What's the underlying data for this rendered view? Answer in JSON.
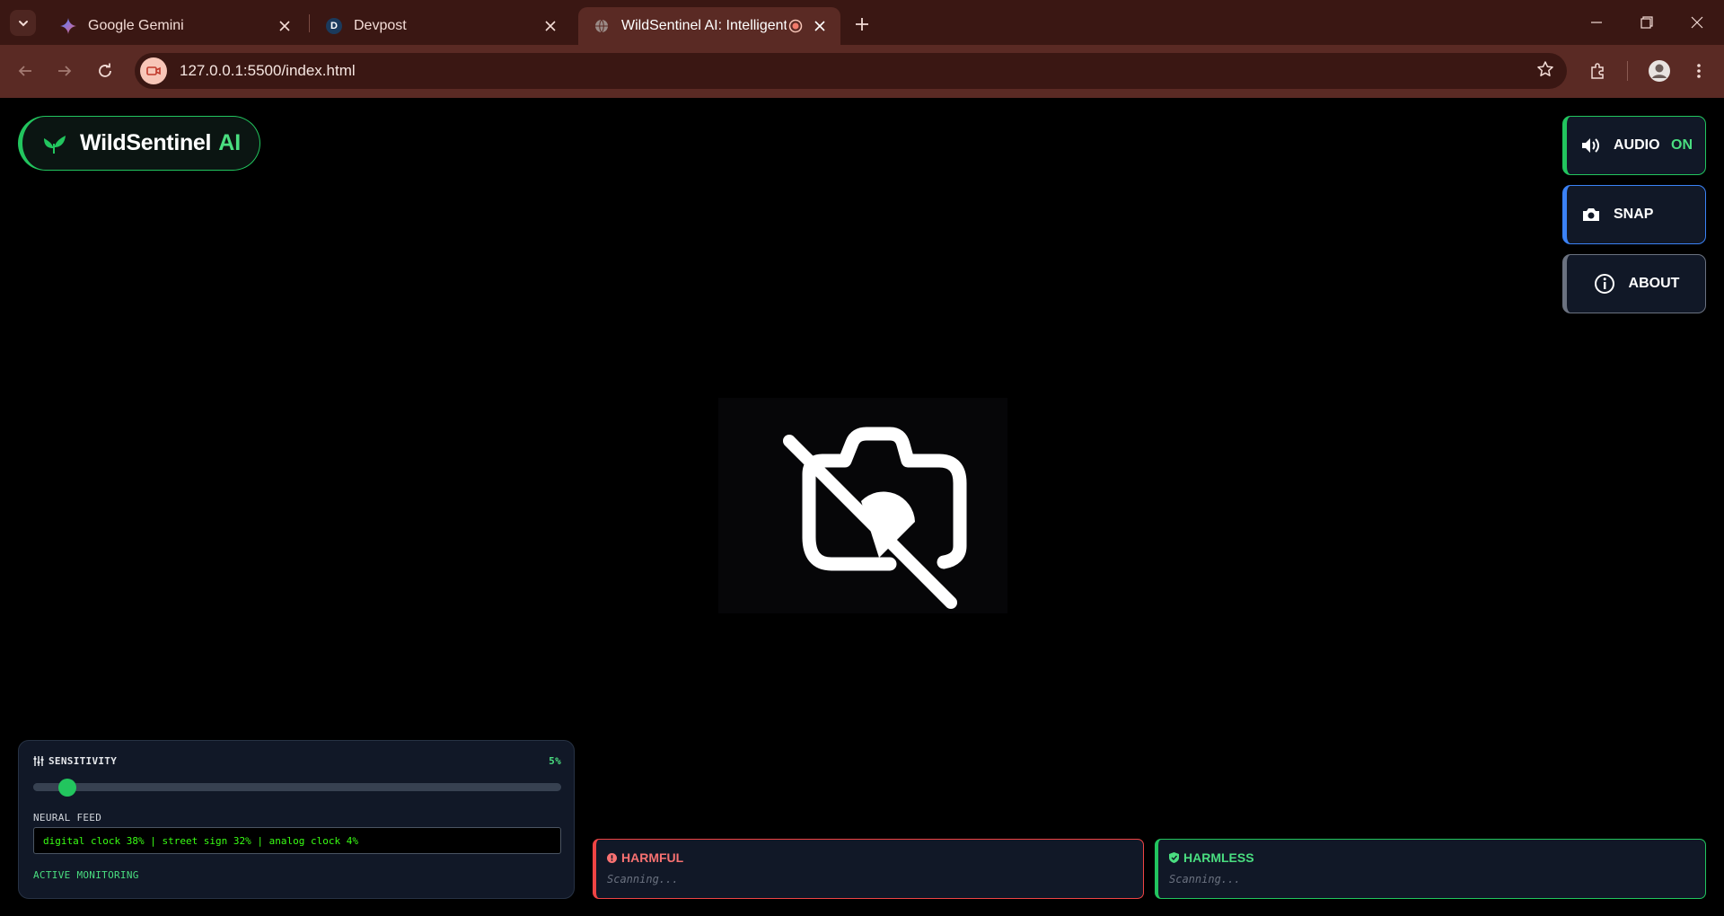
{
  "browser": {
    "tabs": [
      {
        "title": "Google Gemini",
        "icon": "gemini-icon"
      },
      {
        "title": "Devpost",
        "icon": "devpost-icon",
        "badge": "D"
      },
      {
        "title": "WildSentinel AI: Intelligent /",
        "icon": "globe-icon",
        "active": true,
        "recording": true
      }
    ],
    "url": "127.0.0.1:5500/index.html"
  },
  "app": {
    "logo_name": "WildSentinel",
    "logo_ai": "AI",
    "controls": {
      "audio_label": "AUDIO",
      "audio_state": "ON",
      "snap_label": "SNAP",
      "about_label": "ABOUT"
    },
    "camera": {
      "icon": "camera-off-icon"
    },
    "sensitivity": {
      "label": "SENSITIVITY",
      "value_text": "5%",
      "value": 0.05
    },
    "neural_feed": {
      "label": "NEURAL FEED",
      "text": "digital clock 38% | street sign 32% | analog clock 4%"
    },
    "status": "ACTIVE MONITORING",
    "harmful": {
      "label": "HARMFUL",
      "text": "Scanning..."
    },
    "harmless": {
      "label": "HARMLESS",
      "text": "Scanning..."
    },
    "colors": {
      "accent_green": "#22c55e",
      "accent_blue": "#3b82f6",
      "danger_red": "#ef4444",
      "feed_green": "#39ff14"
    }
  }
}
